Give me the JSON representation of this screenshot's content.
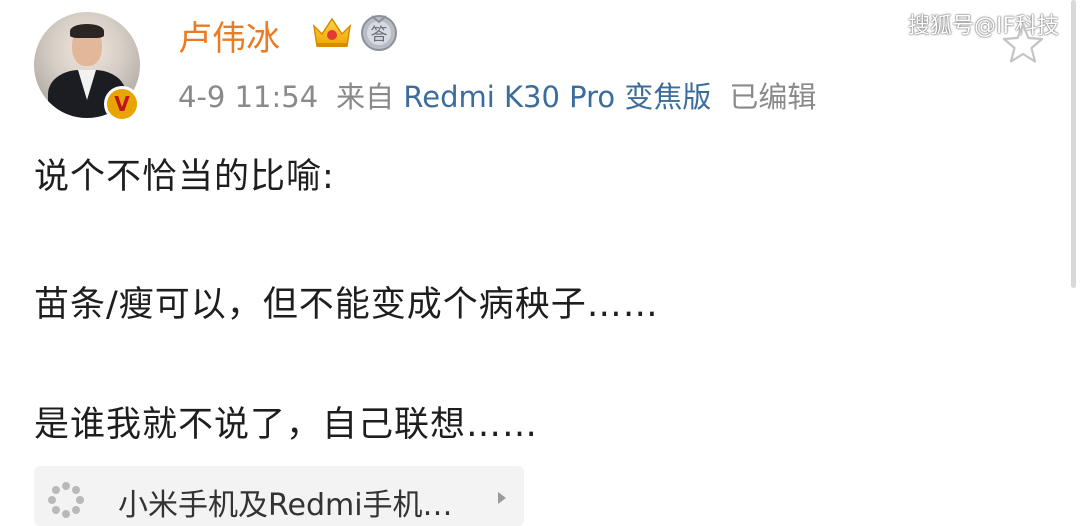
{
  "post": {
    "author": "卢伟冰",
    "time": "4-9 11:54",
    "source_prefix": "来自",
    "device": "Redmi K30 Pro 变焦版",
    "edited": "已编辑",
    "lines": [
      "说个不恰当的比喻:",
      "苗条/瘦可以，但不能变成个病秧子……",
      "是谁我就不说了，自己联想……"
    ],
    "topic": "小米手机及Redmi手机…"
  },
  "watermark": "搜狐号@IF科技",
  "badges": {
    "verified_letter": "V",
    "medal_char": "答"
  },
  "icons": {
    "crown": "crown-icon",
    "medal": "medal-icon",
    "star": "star-icon",
    "topic": "loading-icon",
    "arrow": "chevron-right-icon"
  },
  "colors": {
    "author": "#ed7a1f",
    "device_link": "#3b6d9c",
    "meta": "#8a8a8a",
    "verified_badge": "#e8a400"
  }
}
